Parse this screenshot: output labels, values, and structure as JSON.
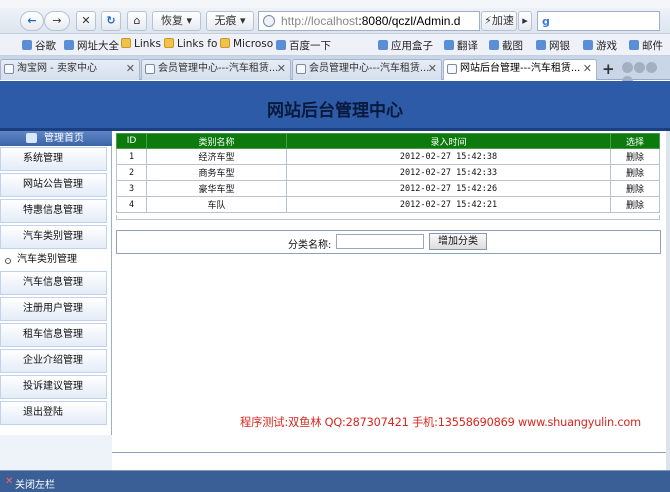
{
  "toolbar": {
    "back_label": "←",
    "forward_label": "→",
    "stop_label": "✕",
    "refresh_label": "↻",
    "home_label": "⌂",
    "restore_label": "恢复",
    "traceless_label": "无痕",
    "url_host": "http://localhost",
    "url_path": ":8080/qczl/Admin.d",
    "accelerate_label": "加速",
    "search_engine_icon": "g-icon"
  },
  "bookmarks": [
    {
      "label": "谷歌",
      "icon": "google-icon"
    },
    {
      "label": "网址大全",
      "icon": "site-icon"
    },
    {
      "label": "Links",
      "icon": "folder-icon"
    },
    {
      "label": "Links fo",
      "icon": "folder-icon"
    },
    {
      "label": "Microso",
      "icon": "folder-icon"
    },
    {
      "label": "百度一下",
      "icon": "baidu-icon"
    },
    {
      "label": "应用盒子",
      "icon": "app-icon"
    },
    {
      "label": "翻译",
      "icon": "translate-icon"
    },
    {
      "label": "截图",
      "icon": "screenshot-icon"
    },
    {
      "label": "网银",
      "icon": "bank-icon"
    },
    {
      "label": "游戏",
      "icon": "game-icon"
    },
    {
      "label": "邮件",
      "icon": "mail-icon"
    }
  ],
  "tabs": [
    {
      "label": "淘宝网 - 卖家中心",
      "active": false
    },
    {
      "label": "会员管理中心---汽车租赁...",
      "active": false
    },
    {
      "label": "会员管理中心---汽车租赁...",
      "active": false
    },
    {
      "label": "网站后台管理---汽车租赁...",
      "active": true
    }
  ],
  "page": {
    "title": "网站后台管理中心"
  },
  "sidebar": {
    "head_label": "管理首页",
    "items": [
      {
        "label": "系统管理"
      },
      {
        "label": "网站公告管理"
      },
      {
        "label": "特惠信息管理"
      },
      {
        "label": "汽车类别管理"
      },
      {
        "label": "汽车类别管理"
      },
      {
        "label": "汽车信息管理"
      },
      {
        "label": "注册用户管理"
      },
      {
        "label": "租车信息管理"
      },
      {
        "label": "企业介绍管理"
      },
      {
        "label": "投诉建议管理"
      },
      {
        "label": "退出登陆"
      }
    ]
  },
  "table": {
    "headers": [
      "ID",
      "类别名称",
      "录入时间",
      "选择"
    ],
    "rows": [
      {
        "id": "1",
        "name": "经济车型",
        "time": "2012-02-27 15:42:38",
        "action": "删除"
      },
      {
        "id": "2",
        "name": "商务车型",
        "time": "2012-02-27 15:42:33",
        "action": "删除"
      },
      {
        "id": "3",
        "name": "豪华车型",
        "time": "2012-02-27 15:42:26",
        "action": "删除"
      },
      {
        "id": "4",
        "name": "车队",
        "time": "2012-02-27 15:42:21",
        "action": "删除"
      }
    ]
  },
  "form": {
    "label": "分类名称:",
    "input_value": "",
    "submit_label": "增加分类"
  },
  "credit": "程序测试:双鱼林 QQ:287307421 手机:13558690869 www.shuangyulin.com",
  "status_bar": {
    "close_sidebar_label": "关闭左栏"
  },
  "colors": {
    "header_bg": "#2e5ba8",
    "table_header_bg": "#0c7a0c",
    "credit_text": "#d8261e",
    "status_bg": "#3a5f97"
  }
}
